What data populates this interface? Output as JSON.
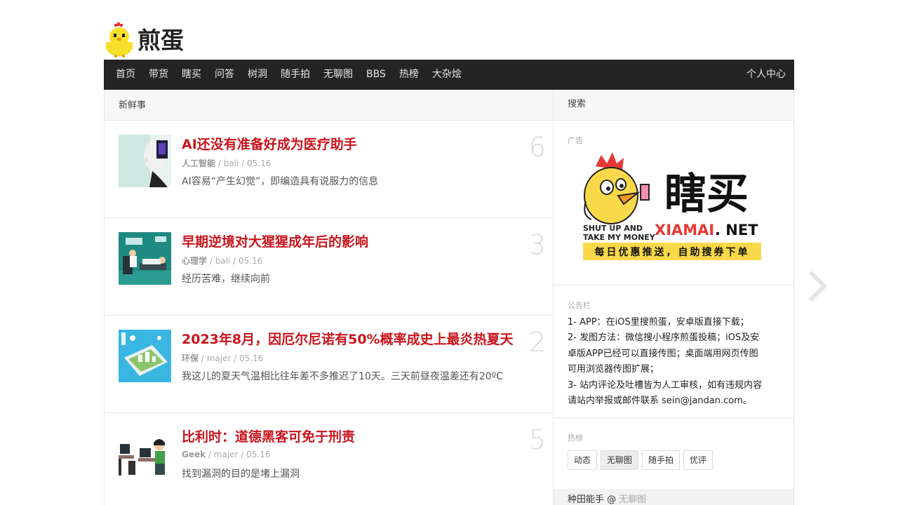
{
  "logo": {
    "text": "煎蛋"
  },
  "nav": {
    "items": [
      "首页",
      "带货",
      "瞎买",
      "问答",
      "树洞",
      "随手拍",
      "无聊图",
      "BBS",
      "热榜",
      "大杂烩"
    ],
    "right": "个人中心"
  },
  "main": {
    "section_title": "新鲜事",
    "posts": [
      {
        "title": "AI还没有准备好成为医疗助手",
        "tag": "人工智能",
        "author": "bali",
        "date": "05.16",
        "excerpt": "AI容易“产生幻觉”，即编造具有说服力的信息",
        "count": "6"
      },
      {
        "title": "早期逆境对大猩猩成年后的影响",
        "tag": "心理学",
        "author": "bali",
        "date": "05.16",
        "excerpt": "经历苦难，继续向前",
        "count": "3"
      },
      {
        "title": "2023年8月，因厄尔尼诺有50%概率成史上最炎热夏天",
        "tag": "环保",
        "author": "majer",
        "date": "05.16",
        "excerpt": "我这儿的夏天气温相比往年差不多推迟了10天。三天前昼夜温差还有20ºC",
        "count": "2"
      },
      {
        "title": "比利时：道德黑客可免于刑责",
        "tag": "Geek",
        "author": "majer",
        "date": "05.16",
        "excerpt": "找到漏洞的目的是堵上漏洞",
        "count": "5"
      }
    ],
    "sep": " / "
  },
  "sidebar": {
    "search_title": "搜索",
    "ad_label": "广告",
    "ad": {
      "brand": "瞎买",
      "domain": "XIAMAI",
      "dot_net": ". NET",
      "slogan": "每日优惠推送，自助搜券下单",
      "bubble1": "SHUT UP AND",
      "bubble2": "TAKE MY MONEY"
    },
    "notice_label": "公告栏",
    "notice_lines": [
      "1- APP：在iOS里搜煎蛋，安卓版直接下载；",
      "2- 发图方法：微信搜小程序煎蛋投稿；iOS及安",
      "卓版APP已经可以直接传图；桌面端用网页传图",
      "可用浏览器传图扩展；",
      "3- 站内评论及吐槽皆为人工审核，如有违规内容",
      "请站内举报或邮件联系 sein@jandan.com。"
    ],
    "hot_label": "热榜",
    "hot_tabs": [
      "动态",
      "无聊图",
      "随手拍",
      "优评"
    ],
    "hot_row": {
      "user": "种田能手",
      "at": " @ ",
      "cat": "无聊图"
    }
  },
  "colors": {
    "nav_bg": "#242424",
    "title_red": "#c8151d",
    "ad_yellow": "#f9d94a"
  }
}
